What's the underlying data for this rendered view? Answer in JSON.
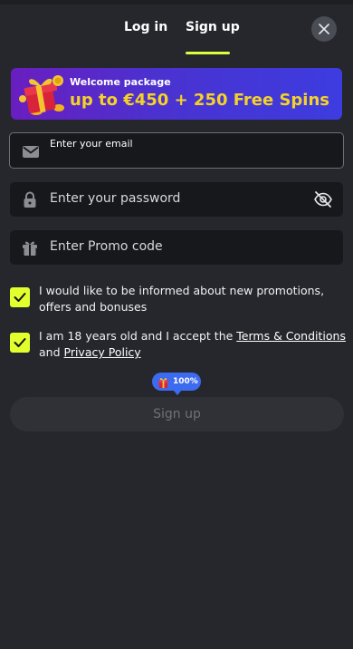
{
  "tabs": {
    "login_label": "Log in",
    "signup_label": "Sign up",
    "active": "signup"
  },
  "banner": {
    "title": "Welcome package",
    "offer": "up to €450 + 250 Free Spins"
  },
  "form": {
    "email_label": "Enter your email",
    "password_placeholder": "Enter your password",
    "promo_placeholder": "Enter Promo code"
  },
  "consents": {
    "promotions_text": "I would like to be informed about new promotions, offers and bonuses",
    "promotions_checked": true,
    "age_prefix": "I am 18 years old and I accept the ",
    "terms_link": "Terms & Conditions",
    "age_and": " and ",
    "privacy_link": "Privacy Policy",
    "age_checked": true
  },
  "bonus_badge": {
    "percent": "100%"
  },
  "submit": {
    "label": "Sign up"
  },
  "colors": {
    "accent": "#d9ff3d",
    "checkbox": "#e2ff2e",
    "offer_text": "#f5d326",
    "background": "#25272c",
    "badge": "#3c6bf0"
  },
  "icons": {
    "email": "envelope-icon",
    "password": "lock-icon",
    "promo": "gift-icon",
    "visibility": "eye-off-icon",
    "close": "close-icon",
    "check": "check-icon"
  }
}
